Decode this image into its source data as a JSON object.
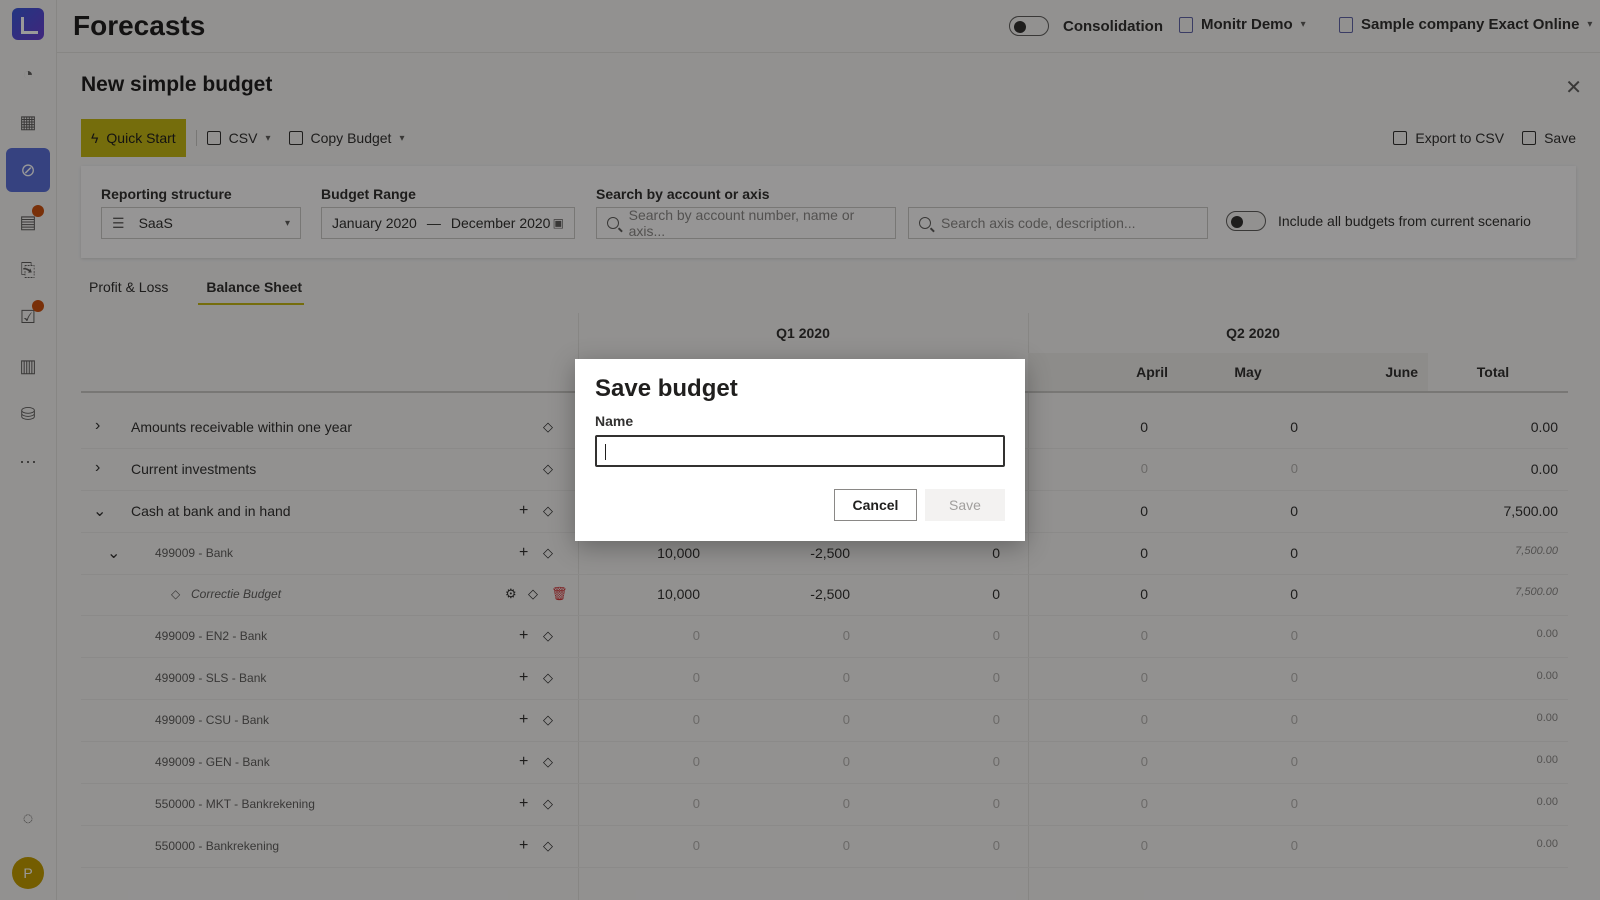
{
  "app": {
    "title": "Forecasts"
  },
  "header": {
    "consolidation_label": "Consolidation",
    "org": "Monitr Demo",
    "company": "Sample company Exact Online"
  },
  "panel": {
    "title": "New simple budget",
    "toolbar": {
      "quick_start": "Quick Start",
      "csv": "CSV",
      "copy_budget": "Copy Budget",
      "export_csv": "Export to CSV",
      "save": "Save"
    },
    "filters": {
      "reporting_structure_label": "Reporting structure",
      "reporting_structure_value": "SaaS",
      "budget_range_label": "Budget Range",
      "range_start": "January 2020",
      "range_sep": "—",
      "range_end": "December 2020",
      "search_label": "Search by account or axis",
      "search_account_placeholder": "Search by account number, name or axis...",
      "search_axis_placeholder": "Search axis code, description...",
      "include_all_label": "Include all budgets from current scenario"
    },
    "tabs": [
      "Profit & Loss",
      "Balance Sheet"
    ],
    "active_tab": "Balance Sheet"
  },
  "grid": {
    "quarters": [
      "Q1 2020",
      "Q2 2020"
    ],
    "months": [
      "April",
      "May",
      "June"
    ],
    "total_label": "Total",
    "rows": [
      {
        "label": "Amounts receivable within one year",
        "q1": [
          "",
          "",
          ""
        ],
        "apr": "0",
        "may": "0",
        "jun": "",
        "total": "0.00"
      },
      {
        "label": "Current investments",
        "q1": [
          "",
          "",
          ""
        ],
        "apr": "0",
        "may": "0",
        "jun": "",
        "total": "0.00"
      },
      {
        "label": "Cash at bank and in hand",
        "q1": [
          "",
          "",
          ""
        ],
        "apr": "0",
        "may": "0",
        "jun": "",
        "total": "7,500.00"
      },
      {
        "label": "499009 - Bank",
        "q1": [
          "10,000",
          "-2,500",
          "0"
        ],
        "apr": "0",
        "may": "0",
        "jun": "",
        "total": "7,500.00"
      },
      {
        "label": "Correctie Budget",
        "q1": [
          "10,000",
          "-2,500",
          "0"
        ],
        "apr": "0",
        "may": "0",
        "jun": "",
        "total": "7,500.00"
      },
      {
        "label": "499009 - EN2 - Bank",
        "q1": [
          "0",
          "0",
          "0"
        ],
        "apr": "0",
        "may": "0",
        "jun": "",
        "total": "0.00"
      },
      {
        "label": "499009 - SLS - Bank",
        "q1": [
          "0",
          "0",
          "0"
        ],
        "apr": "0",
        "may": "0",
        "jun": "",
        "total": "0.00"
      },
      {
        "label": "499009 - CSU - Bank",
        "q1": [
          "0",
          "0",
          "0"
        ],
        "apr": "0",
        "may": "0",
        "jun": "",
        "total": "0.00"
      },
      {
        "label": "499009 - GEN - Bank",
        "q1": [
          "0",
          "0",
          "0"
        ],
        "apr": "0",
        "may": "0",
        "jun": "",
        "total": "0.00"
      },
      {
        "label": "550000 - MKT - Bankrekening",
        "q1": [
          "0",
          "0",
          "0"
        ],
        "apr": "0",
        "may": "0",
        "jun": "",
        "total": "0.00"
      },
      {
        "label": "550000 - Bankrekening",
        "q1": [
          "0",
          "0",
          "0"
        ],
        "apr": "0",
        "may": "0",
        "jun": "",
        "total": "0.00"
      }
    ]
  },
  "dialog": {
    "title": "Save budget",
    "name_label": "Name",
    "name_value": "",
    "cancel": "Cancel",
    "save": "Save"
  },
  "user": {
    "initial": "P"
  }
}
